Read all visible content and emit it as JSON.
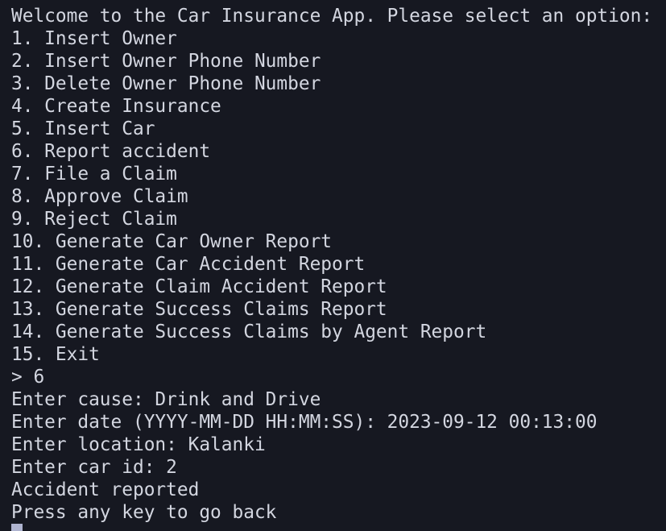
{
  "terminal": {
    "lines": [
      "Welcome to the Car Insurance App. Please select an option:",
      "1. Insert Owner",
      "2. Insert Owner Phone Number",
      "3. Delete Owner Phone Number",
      "4. Create Insurance",
      "5. Insert Car",
      "6. Report accident",
      "7. File a Claim",
      "8. Approve Claim",
      "9. Reject Claim",
      "10. Generate Car Owner Report",
      "11. Generate Car Accident Report",
      "12. Generate Claim Accident Report",
      "13. Generate Success Claims Report",
      "14. Generate Success Claims by Agent Report",
      "15. Exit",
      "> 6",
      "Enter cause: Drink and Drive",
      "Enter date (YYYY-MM-DD HH:MM:SS): 2023-09-12 00:13:00",
      "Enter location: Kalanki",
      "Enter car id: 2",
      "Accident reported",
      "Press any key to go back"
    ]
  }
}
